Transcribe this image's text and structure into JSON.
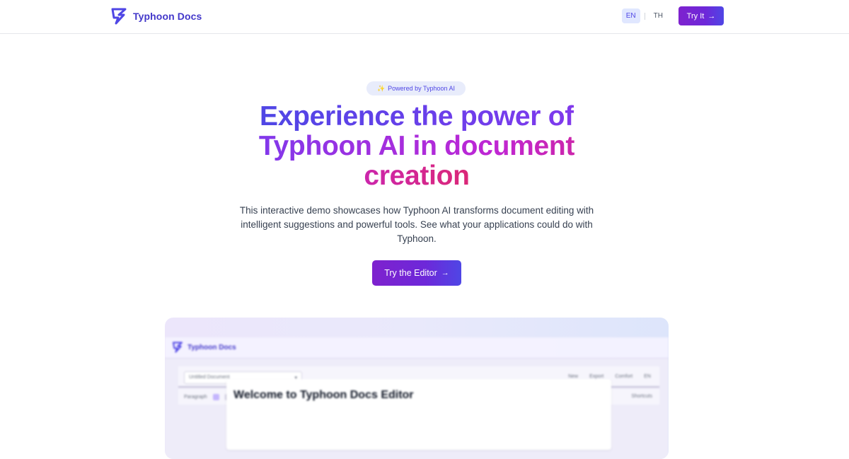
{
  "nav": {
    "brand": "Typhoon Docs",
    "lang_en": "EN",
    "lang_th": "TH",
    "try_label": "Try It"
  },
  "hero": {
    "badge": "Powered by Typhoon AI",
    "badge_icon": "sparkles-icon",
    "headline": "Experience the power of Typhoon AI in document creation",
    "description": "This interactive demo showcases how Typhoon AI transforms document editing with intelligent suggestions and powerful tools. See what your applications could do with Typhoon.",
    "cta_label": "Try the Editor"
  },
  "preview": {
    "brand": "Typhoon Docs",
    "document_select": "Untitled Document",
    "actions": [
      "New",
      "Export",
      "Comfort",
      "EN"
    ],
    "style_select": "Paragraph",
    "shortcuts": "Shortcuts",
    "doc_title": "Welcome to Typhoon Docs Editor"
  },
  "colors": {
    "brand": "#4338ca",
    "accent_start": "#7e22ce",
    "accent_end": "#4f46e5",
    "headline_end": "#db2777"
  }
}
